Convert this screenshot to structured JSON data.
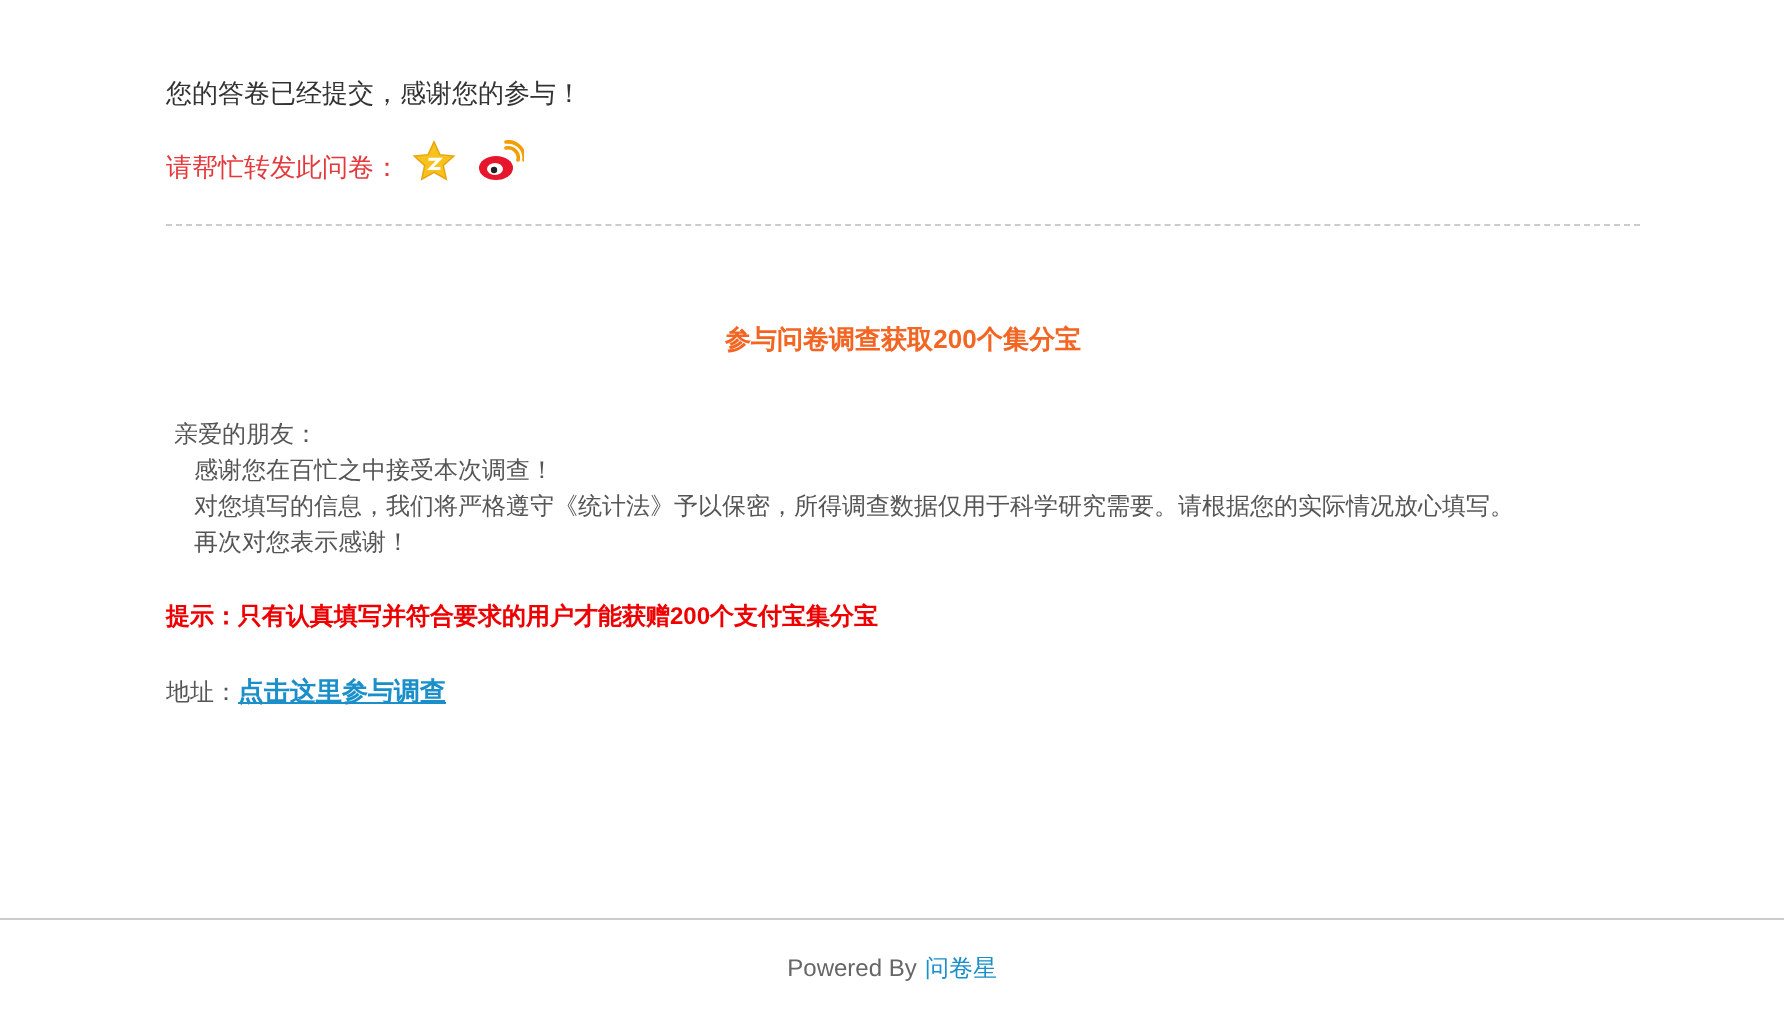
{
  "message": "您的答卷已经提交，感谢您的参与！",
  "share": {
    "label": "请帮忙转发此问卷："
  },
  "title": "参与问卷调查获取200个集分宝",
  "greeting": "亲爱的朋友：",
  "paragraphs": [
    "感谢您在百忙之中接受本次调查！",
    "对您填写的信息，我们将严格遵守《统计法》予以保密，所得调查数据仅用于科学研究需要。请根据您的实际情况放心填写。",
    "再次对您表示感谢！"
  ],
  "tip": "提示：只有认真填写并符合要求的用户才能获赠200个支付宝集分宝",
  "address": {
    "label": "地址：",
    "link": "点击这里参与调查"
  },
  "footer": {
    "prefix": "Powered By",
    "link": "问卷星"
  }
}
